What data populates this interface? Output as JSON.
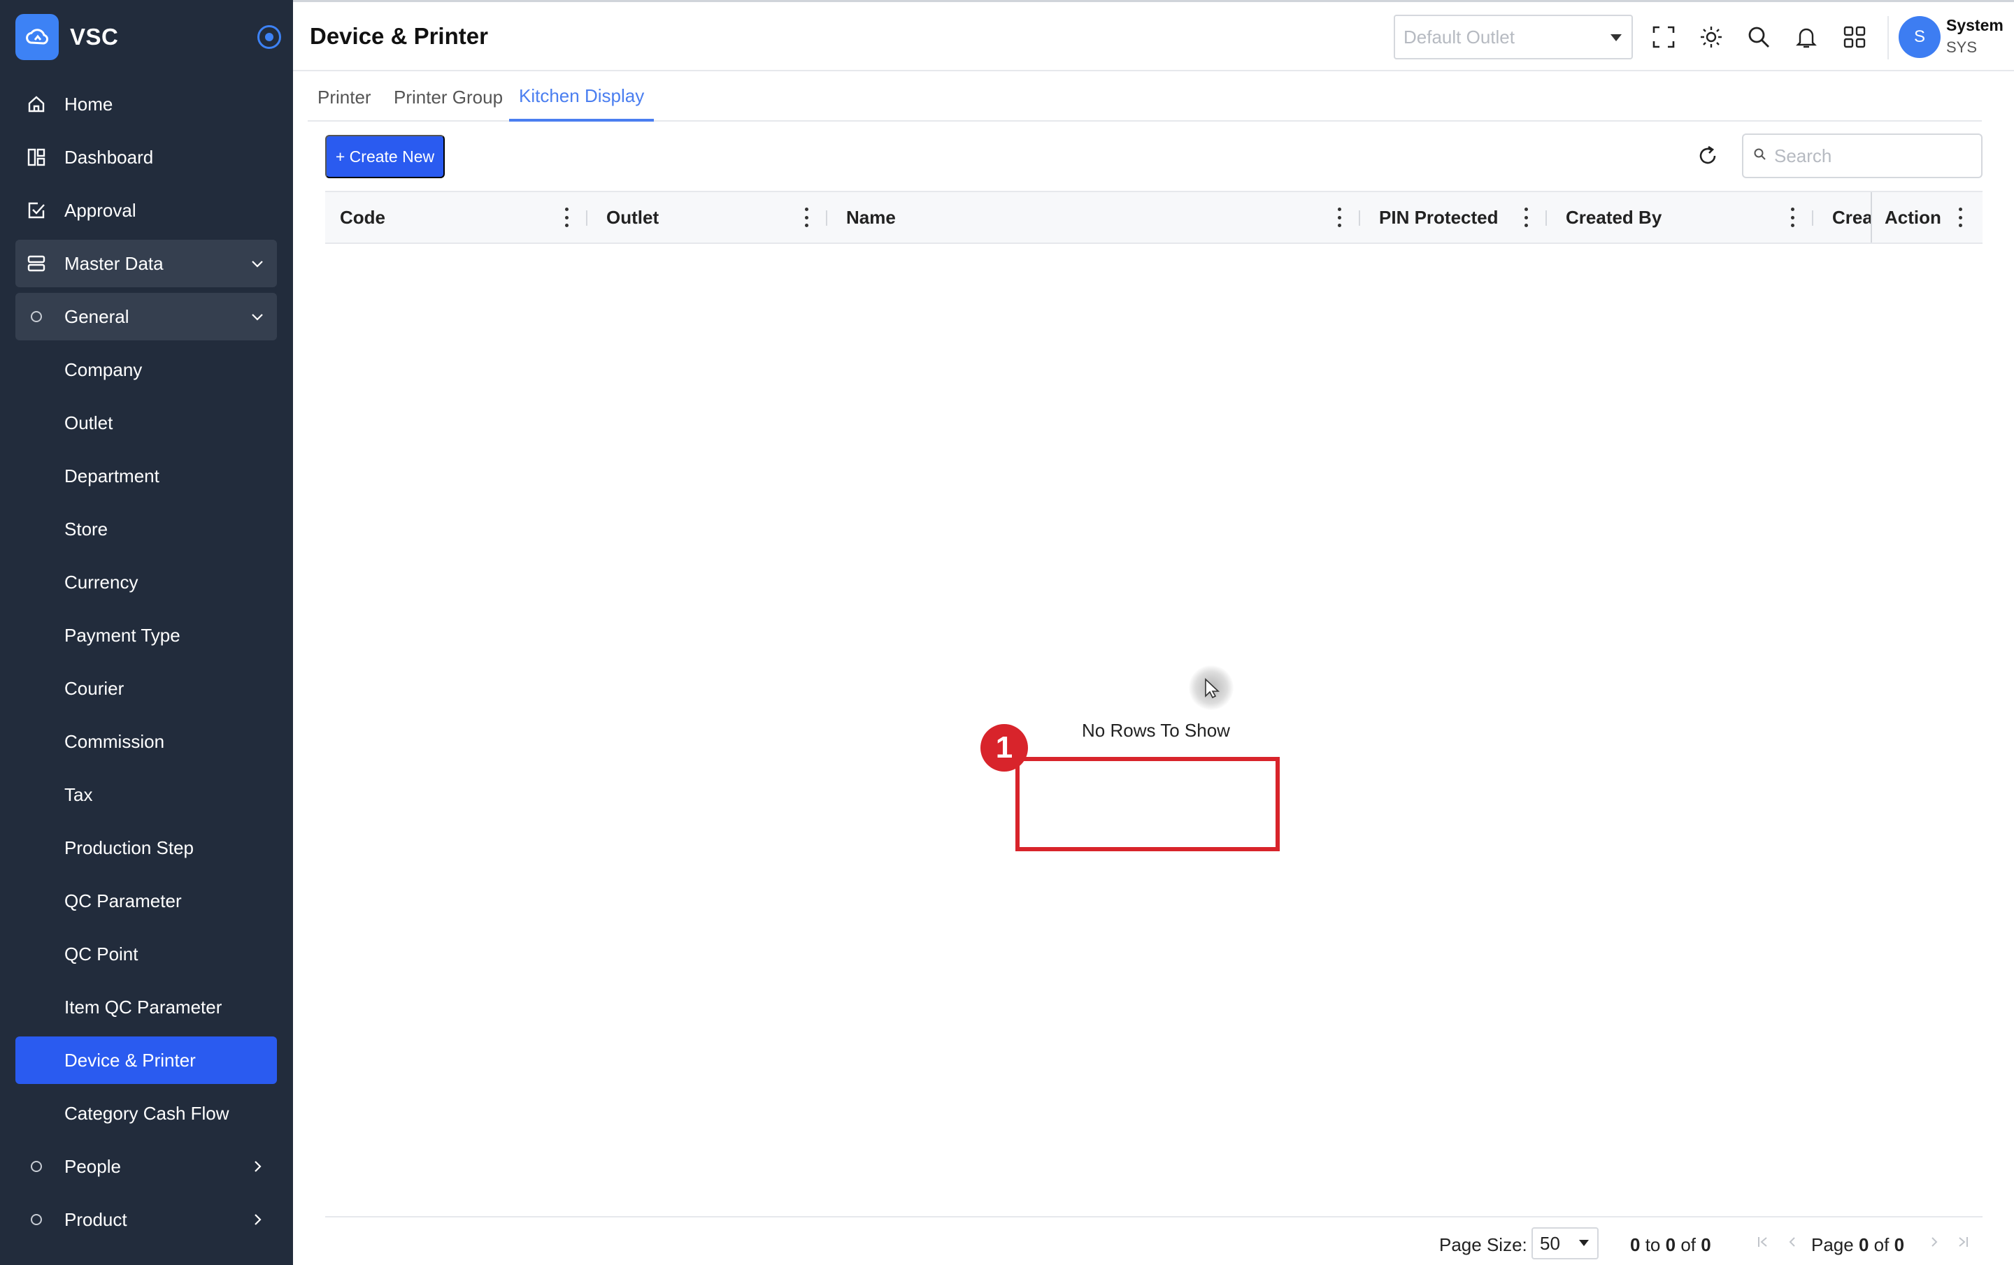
{
  "app": {
    "name": "VSC"
  },
  "sidebar": {
    "items": [
      {
        "label": "Home",
        "icon": "home-icon"
      },
      {
        "label": "Dashboard",
        "icon": "dashboard-icon"
      },
      {
        "label": "Approval",
        "icon": "approval-icon"
      },
      {
        "label": "Master Data",
        "icon": "database-icon"
      },
      {
        "label": "General",
        "icon": "dot-icon"
      },
      {
        "label": "Company"
      },
      {
        "label": "Outlet"
      },
      {
        "label": "Department"
      },
      {
        "label": "Store"
      },
      {
        "label": "Currency"
      },
      {
        "label": "Payment Type"
      },
      {
        "label": "Courier"
      },
      {
        "label": "Commission"
      },
      {
        "label": "Tax"
      },
      {
        "label": "Production Step"
      },
      {
        "label": "QC Parameter"
      },
      {
        "label": "QC Point"
      },
      {
        "label": "Item QC Parameter"
      },
      {
        "label": "Device & Printer"
      },
      {
        "label": "Category Cash Flow"
      },
      {
        "label": "People",
        "icon": "dot-icon"
      },
      {
        "label": "Product",
        "icon": "dot-icon"
      }
    ]
  },
  "header": {
    "title": "Device & Printer",
    "outlet_placeholder": "Default Outlet",
    "user": {
      "initial": "S",
      "name": "System",
      "code": "SYS"
    }
  },
  "tabs": [
    {
      "label": "Printer"
    },
    {
      "label": "Printer Group"
    },
    {
      "label": "Kitchen Display"
    }
  ],
  "toolbar": {
    "create_label": "+ Create New",
    "search_placeholder": "Search"
  },
  "grid": {
    "columns": [
      "Code",
      "Outlet",
      "Name",
      "PIN Protected",
      "Created By",
      "Crea",
      "Action"
    ],
    "empty_text": "No Rows To Show"
  },
  "annotation": {
    "badge": "1"
  },
  "footer": {
    "page_size_label": "Page Size:",
    "page_size_value": "50",
    "range_a": "0",
    "range_to": "to",
    "range_b": "0",
    "range_of": "of",
    "range_total": "0",
    "page_label": "Page",
    "page_current": "0",
    "page_of": "of",
    "page_total": "0"
  },
  "colors": {
    "sidebar_bg": "#222c3c",
    "primary": "#2a5bf0",
    "tab_active": "#4a7ef0",
    "annotation": "#d8242b"
  }
}
